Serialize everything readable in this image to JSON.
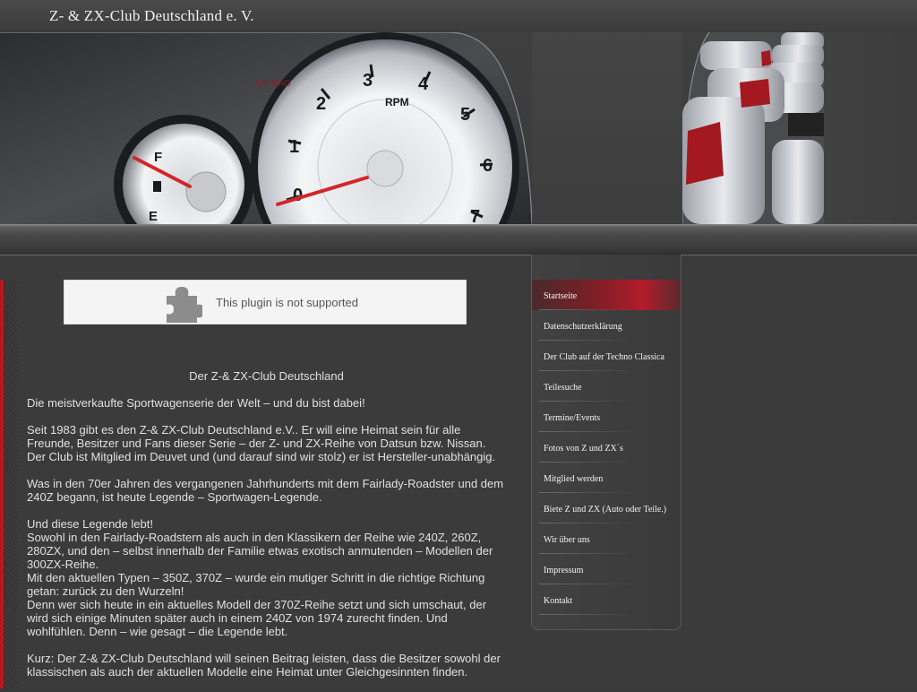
{
  "header": {
    "site_title": "Z- & ZX-Club Deutschland e. V."
  },
  "banner": {
    "gauge_numbers": [
      "0",
      "1",
      "2",
      "3",
      "4",
      "5",
      "6",
      "7"
    ],
    "rpm_label": "RPM",
    "fuel_full": "F",
    "fuel_empty": "E",
    "airbag_label": "AIR BAG"
  },
  "plugin": {
    "message": "This plugin is not supported",
    "icon": "puzzle-piece-icon"
  },
  "article": {
    "heading": "Der Z-& ZX-Club Deutschland",
    "paragraphs": [
      "Die meistverkaufte Sportwagenserie der Welt – und du bist dabei!",
      "Seit 1983 gibt es den Z-& ZX-Club Deutschland e.V.. Er will eine Heimat sein für alle Freunde, Besitzer und Fans dieser Serie – der Z- und ZX-Reihe von Datsun bzw. Nissan. Der Club ist Mitglied im Deuvet und (und darauf sind wir stolz) er ist Hersteller-unabhängig.",
      "Was in den 70er Jahren des vergangenen Jahrhunderts mit dem Fairlady-Roadster und dem 240Z begann, ist heute Legende – Sportwagen-Legende.",
      "Und diese Legende lebt!\nSowohl in den Fairlady-Roadstern als auch in den Klassikern der Reihe wie 240Z, 260Z, 280ZX, und den – selbst innerhalb der Familie etwas exotisch anmutenden – Modellen der 300ZX-Reihe.\nMit den aktuellen Typen – 350Z, 370Z – wurde ein mutiger Schritt in die richtige Richtung getan: zurück zu den Wurzeln!\nDenn wer sich heute in ein aktuelles Modell der 370Z-Reihe setzt und sich umschaut, der wird sich einige Minuten später auch in einem 240Z von 1974 zurecht finden. Und wohlfühlen. Denn – wie gesagt – die Legende lebt.",
      "Kurz: Der Z-& ZX-Club Deutschland will seinen Beitrag leisten, dass die Besitzer sowohl der klassischen als auch der aktuellen Modelle eine Heimat unter Gleichgesinnten finden."
    ]
  },
  "nav": {
    "active_index": 0,
    "active_color": "#b11c2a",
    "items": [
      {
        "label": "Startseite"
      },
      {
        "label": "Datenschutzerklärung"
      },
      {
        "label": "Der Club auf der Techno Classica"
      },
      {
        "label": "Teilesuche"
      },
      {
        "label": "Termine/Events"
      },
      {
        "label": "Fotos von Z und ZX´s"
      },
      {
        "label": "Mitglied werden"
      },
      {
        "label": "Biete Z und ZX (Auto oder Teile.)"
      },
      {
        "label": "Wir über uns"
      },
      {
        "label": "Impressum"
      },
      {
        "label": "Kontakt"
      }
    ]
  }
}
